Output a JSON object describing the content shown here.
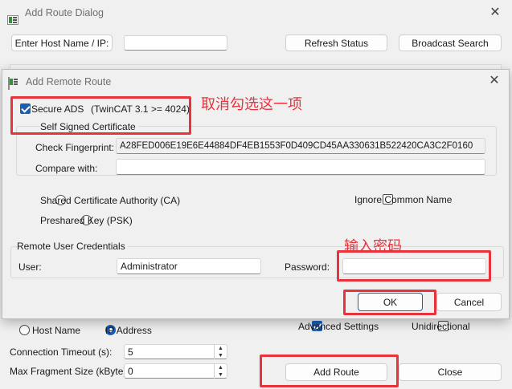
{
  "back_dialog": {
    "title": "Add Route Dialog",
    "close_glyph": "✕",
    "enter_host_label": "Enter Host Name / IP:",
    "host_value": "",
    "refresh_label": "Refresh Status",
    "broadcast_label": "Broadcast Search",
    "host_name_radio": "Host Name",
    "ip_address_radio": "IP Address",
    "advanced_settings": "Advanced Settings",
    "unidirectional": "Unidirectional",
    "timeout_label": "Connection Timeout (s):",
    "timeout_value": "5",
    "fragment_label": "Max Fragment Size (kByte):",
    "fragment_value": "0",
    "add_route_label": "Add Route",
    "close_label": "Close"
  },
  "remote_dialog": {
    "title": "Add Remote Route",
    "close_glyph": "✕",
    "secure_ads_label": "Secure ADS",
    "twincat_note": "(TwinCAT 3.1 >= 4024)",
    "self_signed_label": "Self Signed Certificate",
    "check_fp_label": "Check Fingerprint:",
    "check_fp_value": "A28FED006E19E6E44884DF4EB1553F0D409CD45AA330631B522420CA3C2F0160",
    "compare_label": "Compare with:",
    "compare_value": "",
    "shared_ca_label": "Shared Certificate Authority (CA)",
    "ignore_cn_label": "Ignore Common Name",
    "psk_label": "Preshared Key (PSK)",
    "credentials_label": "Remote User Credentials",
    "user_label": "User:",
    "user_value": "Administrator",
    "password_label": "Password:",
    "password_value": "",
    "ok_label": "OK",
    "cancel_label": "Cancel"
  },
  "annotations": {
    "uncheck_note": "取消勾选这一项",
    "password_note": "输入密码"
  },
  "colors": {
    "annotation_red": "#e8323c",
    "accent_blue": "#1a5fb4"
  }
}
